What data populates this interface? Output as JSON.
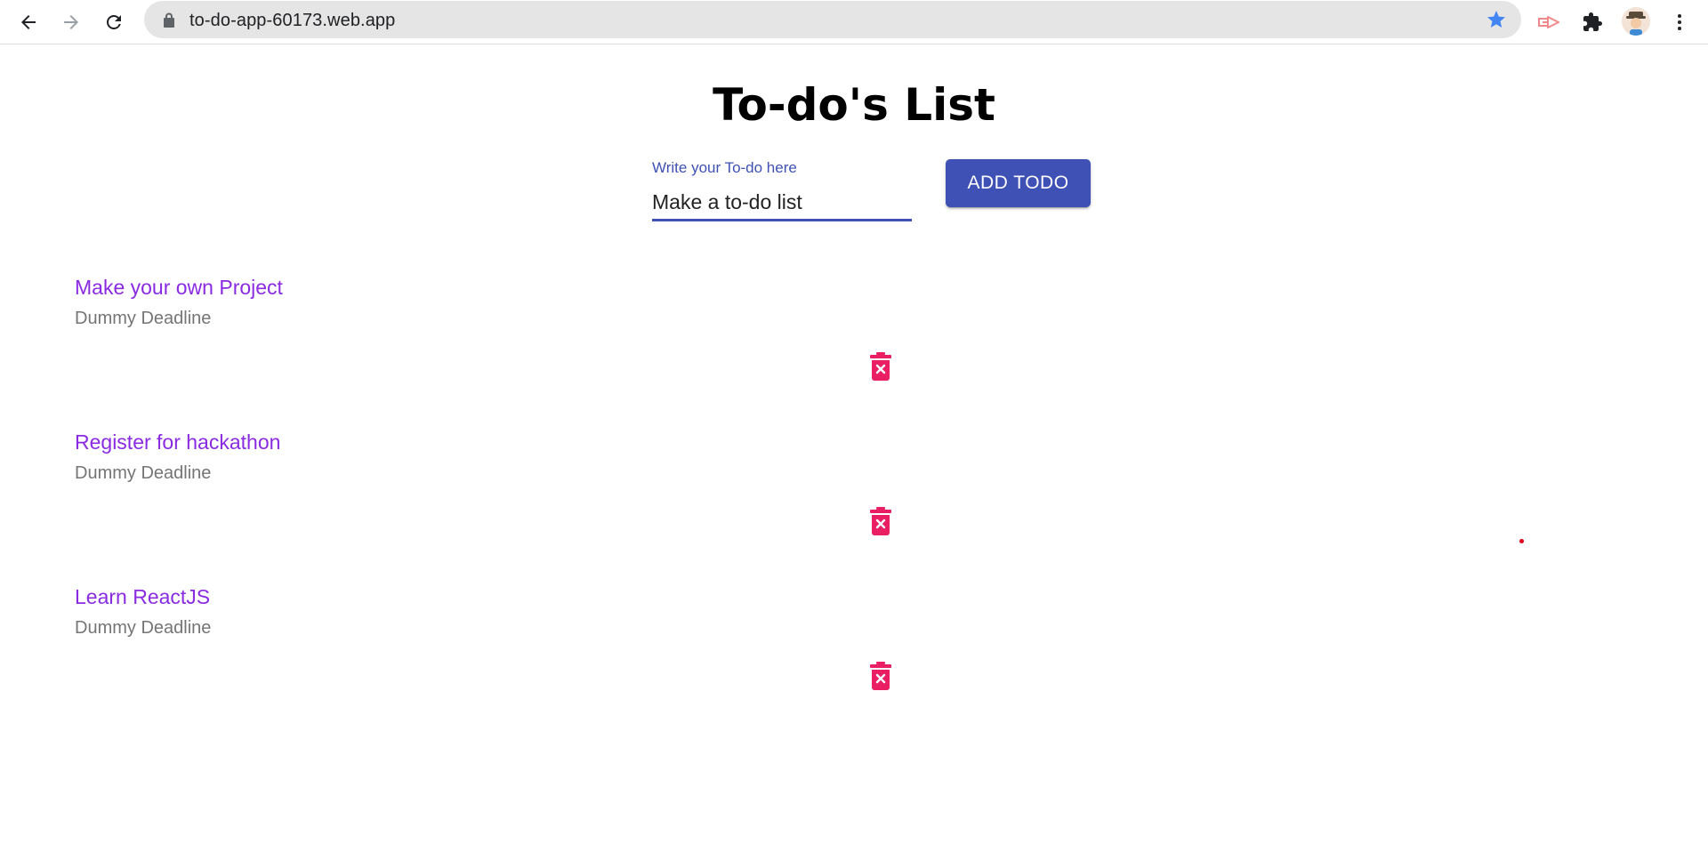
{
  "browser": {
    "url": "to-do-app-60173.web.app",
    "star_color": "#4285f4"
  },
  "page": {
    "title": "To-do's List"
  },
  "form": {
    "input_label": "Write your To-do here",
    "input_value": "Make a to-do list",
    "add_button_label": "ADD TODO",
    "accent_color": "#3f51b5"
  },
  "todos": [
    {
      "title": "Make your own Project",
      "deadline": "Dummy Deadline"
    },
    {
      "title": "Register for hackathon",
      "deadline": "Dummy Deadline"
    },
    {
      "title": "Learn ReactJS",
      "deadline": "Dummy Deadline"
    }
  ],
  "colors": {
    "todo_title": "#8a2be2",
    "deadline": "#757575",
    "delete_icon": "#e91e63"
  },
  "icons": {
    "back": "arrow-left-icon",
    "forward": "arrow-right-icon",
    "reload": "reload-icon",
    "lock": "lock-icon",
    "bookmark": "star-icon",
    "extension_cast": "cast-extension-icon",
    "extensions": "puzzle-icon",
    "menu": "more-vertical-icon",
    "delete": "delete-forever-icon"
  }
}
